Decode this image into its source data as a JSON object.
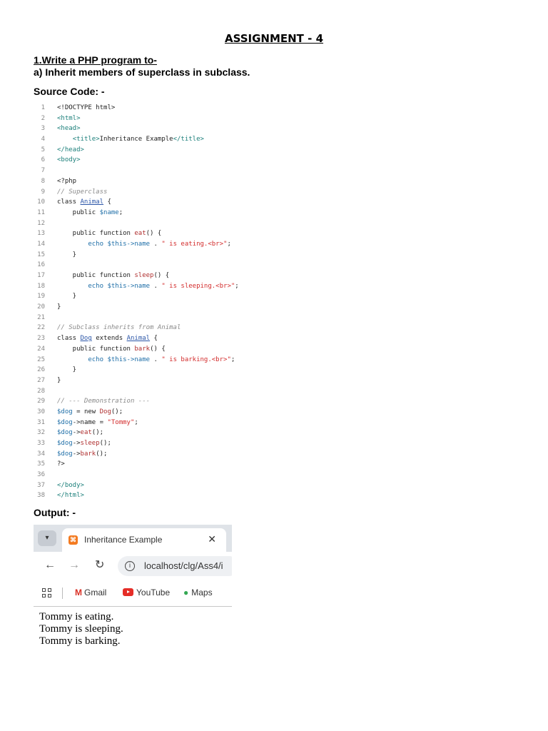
{
  "doc": {
    "title": "ASSIGNMENT - 4",
    "question": "1.Write a PHP program to-",
    "subquestion": "a) Inherit members of superclass in subclass.",
    "source_label": "Source Code: -",
    "output_label": "Output: -"
  },
  "code_lines": [
    {
      "n": "1",
      "parts": [
        {
          "t": "<!DOCTYPE html>",
          "c": "kw"
        }
      ]
    },
    {
      "n": "2",
      "parts": [
        {
          "t": "<html>",
          "c": "tag"
        }
      ]
    },
    {
      "n": "3",
      "parts": [
        {
          "t": "<head>",
          "c": "tag"
        }
      ]
    },
    {
      "n": "4",
      "parts": [
        {
          "t": "    ",
          "c": "kw"
        },
        {
          "t": "<title>",
          "c": "tag"
        },
        {
          "t": "Inheritance Example",
          "c": "kw"
        },
        {
          "t": "</title>",
          "c": "tag"
        }
      ]
    },
    {
      "n": "5",
      "parts": [
        {
          "t": "</head>",
          "c": "tag"
        }
      ]
    },
    {
      "n": "6",
      "parts": [
        {
          "t": "<body>",
          "c": "tag"
        }
      ]
    },
    {
      "n": "7",
      "parts": []
    },
    {
      "n": "8",
      "parts": [
        {
          "t": "<?php",
          "c": "kw"
        }
      ]
    },
    {
      "n": "9",
      "parts": [
        {
          "t": "// Superclass",
          "c": "com"
        }
      ]
    },
    {
      "n": "10",
      "parts": [
        {
          "t": "class ",
          "c": "kw"
        },
        {
          "t": "Animal",
          "c": "cls"
        },
        {
          "t": " {",
          "c": "kw"
        }
      ]
    },
    {
      "n": "11",
      "parts": [
        {
          "t": "    public ",
          "c": "kw"
        },
        {
          "t": "$name",
          "c": "var"
        },
        {
          "t": ";",
          "c": "kw"
        }
      ]
    },
    {
      "n": "12",
      "parts": []
    },
    {
      "n": "13",
      "parts": [
        {
          "t": "    public function ",
          "c": "kw"
        },
        {
          "t": "eat",
          "c": "fn"
        },
        {
          "t": "() {",
          "c": "kw"
        }
      ]
    },
    {
      "n": "14",
      "parts": [
        {
          "t": "        echo ",
          "c": "var"
        },
        {
          "t": "$this->name",
          "c": "var"
        },
        {
          "t": " . ",
          "c": "kw"
        },
        {
          "t": "\" is eating.<br>\"",
          "c": "str"
        },
        {
          "t": ";",
          "c": "kw"
        }
      ]
    },
    {
      "n": "15",
      "parts": [
        {
          "t": "    }",
          "c": "kw"
        }
      ]
    },
    {
      "n": "16",
      "parts": []
    },
    {
      "n": "17",
      "parts": [
        {
          "t": "    public function ",
          "c": "kw"
        },
        {
          "t": "sleep",
          "c": "fn"
        },
        {
          "t": "() {",
          "c": "kw"
        }
      ]
    },
    {
      "n": "18",
      "parts": [
        {
          "t": "        echo ",
          "c": "var"
        },
        {
          "t": "$this->name",
          "c": "var"
        },
        {
          "t": " . ",
          "c": "kw"
        },
        {
          "t": "\" is sleeping.<br>\"",
          "c": "str"
        },
        {
          "t": ";",
          "c": "kw"
        }
      ]
    },
    {
      "n": "19",
      "parts": [
        {
          "t": "    }",
          "c": "kw"
        }
      ]
    },
    {
      "n": "20",
      "parts": [
        {
          "t": "}",
          "c": "kw"
        }
      ]
    },
    {
      "n": "21",
      "parts": []
    },
    {
      "n": "22",
      "parts": [
        {
          "t": "// Subclass inherits from Animal",
          "c": "com"
        }
      ]
    },
    {
      "n": "23",
      "parts": [
        {
          "t": "class ",
          "c": "kw"
        },
        {
          "t": "Dog",
          "c": "cls"
        },
        {
          "t": " extends ",
          "c": "kw"
        },
        {
          "t": "Animal",
          "c": "cls"
        },
        {
          "t": " {",
          "c": "kw"
        }
      ]
    },
    {
      "n": "24",
      "parts": [
        {
          "t": "    public function ",
          "c": "kw"
        },
        {
          "t": "bark",
          "c": "fn"
        },
        {
          "t": "() {",
          "c": "kw"
        }
      ]
    },
    {
      "n": "25",
      "parts": [
        {
          "t": "        echo ",
          "c": "var"
        },
        {
          "t": "$this->name",
          "c": "var"
        },
        {
          "t": " . ",
          "c": "kw"
        },
        {
          "t": "\" is barking.<br>\"",
          "c": "str"
        },
        {
          "t": ";",
          "c": "kw"
        }
      ]
    },
    {
      "n": "26",
      "parts": [
        {
          "t": "    }",
          "c": "kw"
        }
      ]
    },
    {
      "n": "27",
      "parts": [
        {
          "t": "}",
          "c": "kw"
        }
      ]
    },
    {
      "n": "28",
      "parts": []
    },
    {
      "n": "29",
      "parts": [
        {
          "t": "// --- Demonstration ---",
          "c": "com"
        }
      ]
    },
    {
      "n": "30",
      "parts": [
        {
          "t": "$dog",
          "c": "var"
        },
        {
          "t": " = new ",
          "c": "kw"
        },
        {
          "t": "Dog",
          "c": "fn"
        },
        {
          "t": "();",
          "c": "kw"
        }
      ]
    },
    {
      "n": "31",
      "parts": [
        {
          "t": "$dog",
          "c": "var"
        },
        {
          "t": "->name = ",
          "c": "kw"
        },
        {
          "t": "\"Tommy\"",
          "c": "str"
        },
        {
          "t": ";",
          "c": "kw"
        }
      ]
    },
    {
      "n": "32",
      "parts": [
        {
          "t": "$dog",
          "c": "var"
        },
        {
          "t": "->",
          "c": "kw"
        },
        {
          "t": "eat",
          "c": "fn"
        },
        {
          "t": "();",
          "c": "kw"
        }
      ]
    },
    {
      "n": "33",
      "parts": [
        {
          "t": "$dog",
          "c": "var"
        },
        {
          "t": "->",
          "c": "kw"
        },
        {
          "t": "sleep",
          "c": "fn"
        },
        {
          "t": "();",
          "c": "kw"
        }
      ]
    },
    {
      "n": "34",
      "parts": [
        {
          "t": "$dog",
          "c": "var"
        },
        {
          "t": "->",
          "c": "kw"
        },
        {
          "t": "bark",
          "c": "fn"
        },
        {
          "t": "();",
          "c": "kw"
        }
      ]
    },
    {
      "n": "35",
      "parts": [
        {
          "t": "?>",
          "c": "kw"
        }
      ]
    },
    {
      "n": "36",
      "parts": []
    },
    {
      "n": "37",
      "parts": [
        {
          "t": "</body>",
          "c": "tag"
        }
      ]
    },
    {
      "n": "38",
      "parts": [
        {
          "t": "</html>",
          "c": "tag"
        }
      ]
    }
  ],
  "browser": {
    "tab_title": "Inheritance Example",
    "tab_close": "✕",
    "url": "localhost/clg/Ass4/i",
    "bookmarks": [
      {
        "label": "Gmail",
        "icon": "gmail-icon"
      },
      {
        "label": "YouTube",
        "icon": "youtube-icon"
      },
      {
        "label": "Maps",
        "icon": "maps-icon"
      }
    ]
  },
  "output_lines": [
    "Tommy is eating.",
    "Tommy is sleeping.",
    "Tommy is barking."
  ]
}
